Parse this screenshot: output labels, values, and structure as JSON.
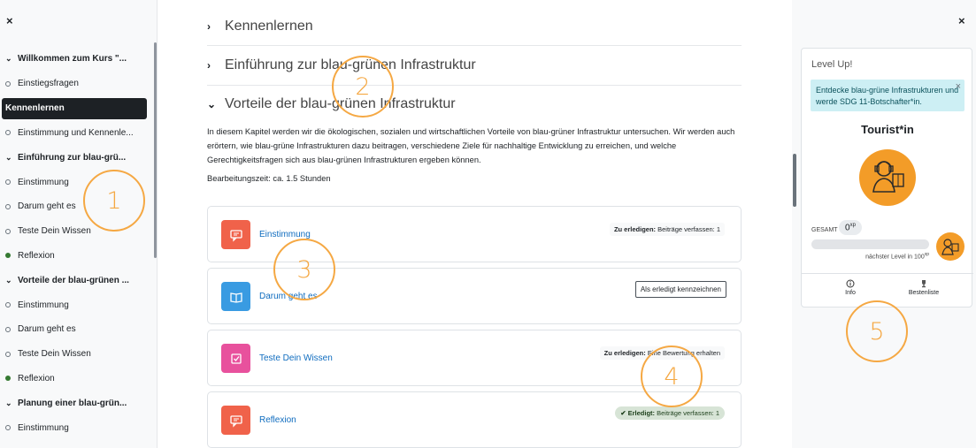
{
  "sidebar": {
    "close": "×",
    "items": [
      {
        "type": "section",
        "label": "Willkommen zum Kurs \"..."
      },
      {
        "type": "activity",
        "status": "open",
        "label": "Einstiegsfragen"
      },
      {
        "type": "section",
        "label": "Kennenlernen",
        "active": true
      },
      {
        "type": "activity",
        "status": "open",
        "label": "Einstimmung und Kennenle..."
      },
      {
        "type": "section",
        "label": "Einführung zur blau-grü..."
      },
      {
        "type": "activity",
        "status": "open",
        "label": "Einstimmung"
      },
      {
        "type": "activity",
        "status": "open",
        "label": "Darum geht es"
      },
      {
        "type": "activity",
        "status": "open",
        "label": "Teste Dein Wissen"
      },
      {
        "type": "activity",
        "status": "done",
        "label": "Reflexion"
      },
      {
        "type": "section",
        "label": "Vorteile der blau-grünen ..."
      },
      {
        "type": "activity",
        "status": "open",
        "label": "Einstimmung"
      },
      {
        "type": "activity",
        "status": "open",
        "label": "Darum geht es"
      },
      {
        "type": "activity",
        "status": "open",
        "label": "Teste Dein Wissen"
      },
      {
        "type": "activity",
        "status": "done",
        "label": "Reflexion"
      },
      {
        "type": "section",
        "label": "Planung einer blau-grün..."
      },
      {
        "type": "activity",
        "status": "open",
        "label": "Einstimmung"
      }
    ]
  },
  "main": {
    "sections": [
      {
        "title": "Kennenlernen",
        "expanded": false
      },
      {
        "title": "Einführung zur blau-grünen Infrastruktur",
        "expanded": false
      },
      {
        "title": "Vorteile der blau-grünen Infrastruktur",
        "expanded": true
      }
    ],
    "description": "In diesem Kapitel werden wir die ökologischen, sozialen und wirtschaftlichen Vorteile von blau-grüner Infrastruktur untersuchen. Wir werden auch erörtern, wie blau-grüne Infrastrukturen dazu beitragen, verschiedene Ziele für nachhaltige Entwicklung zu erreichen, und welche Gerechtigkeitsfragen sich aus blau-grünen Infrastrukturen ergeben können.",
    "duration": "Bearbeitungszeit: ca. 1.5 Stunden",
    "activities": [
      {
        "name": "Einstimmung",
        "icon": "forum-icon",
        "color": "#f0624a",
        "badge_label": "Zu erledigen:",
        "badge_text": "Beiträge verfassen: 1"
      },
      {
        "name": "Darum geht es",
        "icon": "book-icon",
        "color": "#399be2",
        "button": "Als erledigt kennzeichnen"
      },
      {
        "name": "Teste Dein Wissen",
        "icon": "quiz-icon",
        "color": "#e8519d",
        "badge_label": "Zu erledigen:",
        "badge_text": "Eine Bewertung erhalten"
      },
      {
        "name": "Reflexion",
        "icon": "forum-icon",
        "color": "#f0624a",
        "done_label": "✔ Erledigt:",
        "done_text": "Beiträge verfassen: 1"
      }
    ]
  },
  "levelup": {
    "close": "×",
    "title": "Level Up!",
    "alert": "Entdecke blau-grüne Infrastrukturen und werde SDG 11-Botschafter*in.",
    "alert_close": "×",
    "rank": "Tourist*in",
    "gesamt": "GESAMT",
    "xp": "0",
    "xp_unit": "xp",
    "progress": 0.0,
    "next_prefix": "nächster Level in",
    "next_value": "100",
    "next_unit": "xp",
    "info": "Info",
    "leaderboard": "Bestenliste",
    "accent": "#f39c28"
  },
  "annotations": [
    "1",
    "2",
    "3",
    "4",
    "5"
  ]
}
